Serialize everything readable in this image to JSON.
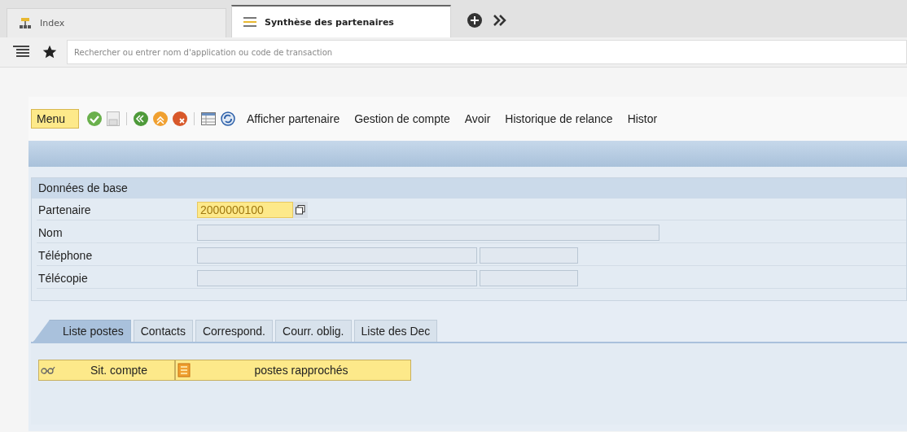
{
  "browser_tabs": [
    {
      "label": "Index",
      "selected": false
    },
    {
      "label": "Synthèse des partenaires",
      "selected": true
    }
  ],
  "command_field": {
    "placeholder": "Rechercher ou entrer nom d'application ou code de transaction"
  },
  "toolbar": {
    "menu": "Menu",
    "actions": [
      "Afficher partenaire",
      "Gestion de compte",
      "Avoir",
      "Historique de relance",
      "Histor"
    ]
  },
  "basic_data": {
    "title": "Données de base",
    "rows": [
      {
        "label": "Partenaire",
        "kind": "key",
        "value": "2000000100"
      },
      {
        "label": "Nom",
        "kind": "wide"
      },
      {
        "label": "Téléphone",
        "kind": "split"
      },
      {
        "label": "Télécopie",
        "kind": "split"
      }
    ]
  },
  "tabs": [
    {
      "label": "Liste postes",
      "selected": true
    },
    {
      "label": "Contacts",
      "selected": false
    },
    {
      "label": "Correspond.",
      "selected": false
    },
    {
      "label": "Courr. oblig.",
      "selected": false
    },
    {
      "label": "Liste des Dec",
      "selected": false
    }
  ],
  "tab_buttons": [
    {
      "label": "Sit. compte",
      "kind": "glasses"
    },
    {
      "label": "postes rapprochés",
      "kind": "document"
    }
  ]
}
